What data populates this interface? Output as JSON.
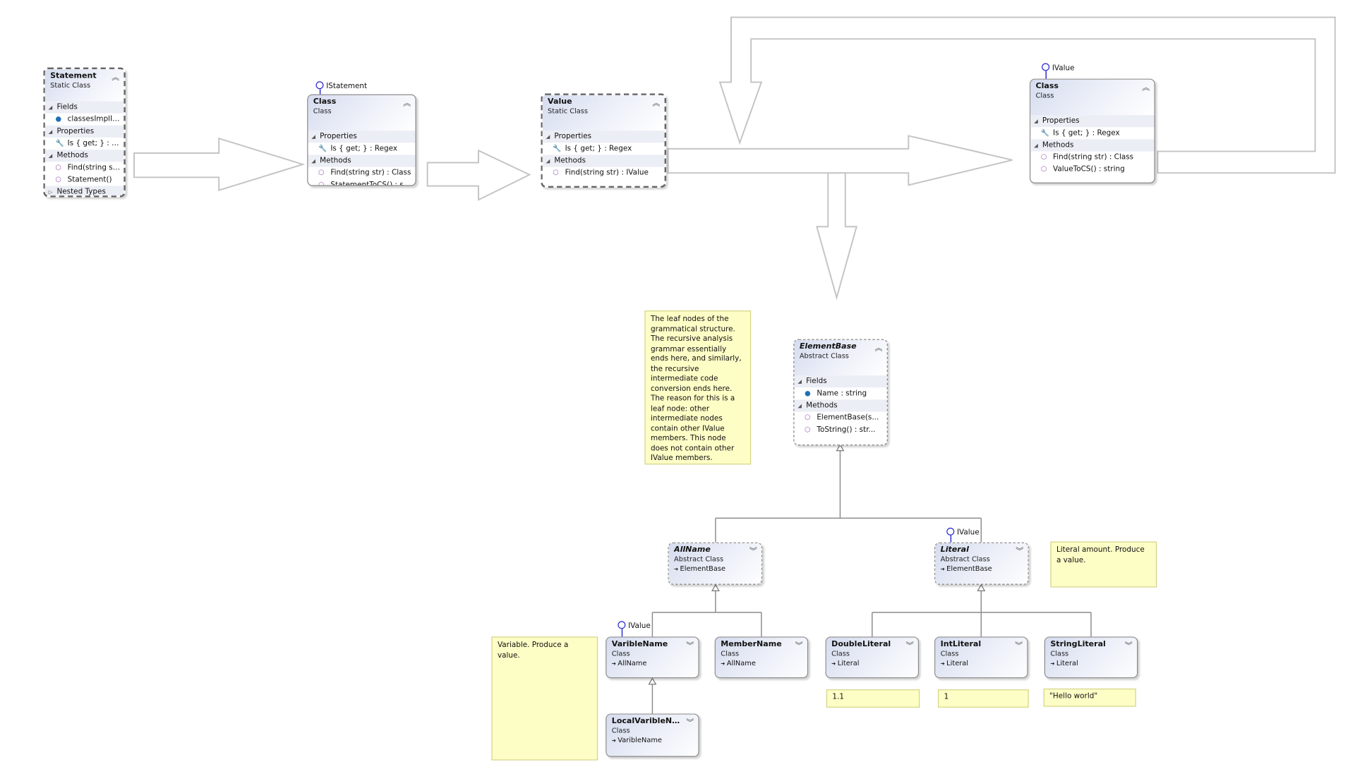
{
  "classes": [
    {
      "id": "statement",
      "name": "Statement",
      "stereotype": "Static Class",
      "style": "dashed",
      "collapse_icon": "chevron-double-up",
      "sections": [
        {
          "label": "Fields",
          "members": [
            {
              "icon": "field-private-icon",
              "text": "classesImplISt..."
            }
          ]
        },
        {
          "label": "Properties",
          "members": [
            {
              "icon": "property-wrench-icon",
              "text": "Is { get; } : Reg..."
            }
          ]
        },
        {
          "label": "Methods",
          "members": [
            {
              "icon": "method-icon",
              "text": "Find(string str..."
            },
            {
              "icon": "method-private-icon",
              "text": "Statement()"
            }
          ]
        },
        {
          "label": "Nested Types",
          "collapsed": true,
          "members": []
        }
      ]
    },
    {
      "id": "class-istatement",
      "name": "Class",
      "stereotype": "Class",
      "style": "solid",
      "collapse_icon": "chevron-double-up",
      "interface": "IStatement",
      "sections": [
        {
          "label": "Properties",
          "members": [
            {
              "icon": "property-wrench-icon",
              "text": "Is { get; } : Regex"
            }
          ]
        },
        {
          "label": "Methods",
          "members": [
            {
              "icon": "method-icon",
              "text": "Find(string str) : Class"
            },
            {
              "icon": "method-icon",
              "text": "StatementToCS() : stri..."
            }
          ]
        }
      ]
    },
    {
      "id": "value",
      "name": "Value",
      "stereotype": "Static Class",
      "style": "dashed",
      "collapse_icon": "chevron-double-up",
      "sections": [
        {
          "label": "Properties",
          "members": [
            {
              "icon": "property-wrench-icon",
              "text": "Is { get; } : Regex"
            }
          ]
        },
        {
          "label": "Methods",
          "members": [
            {
              "icon": "method-icon",
              "text": "Find(string str) : IValue"
            }
          ]
        }
      ]
    },
    {
      "id": "class-ivalue",
      "name": "Class",
      "stereotype": "Class",
      "style": "solid",
      "collapse_icon": "chevron-double-up",
      "interface": "IValue",
      "sections": [
        {
          "label": "Properties",
          "members": [
            {
              "icon": "property-wrench-icon",
              "text": "Is { get; } : Regex"
            }
          ]
        },
        {
          "label": "Methods",
          "members": [
            {
              "icon": "method-icon",
              "text": "Find(string str) : Class"
            },
            {
              "icon": "method-icon",
              "text": "ValueToCS() : string"
            }
          ]
        }
      ]
    },
    {
      "id": "elementbase",
      "name": "ElementBase",
      "italic": true,
      "stereotype": "Abstract Class",
      "style": "dotted",
      "collapse_icon": "chevron-double-up",
      "sections": [
        {
          "label": "Fields",
          "members": [
            {
              "icon": "field-icon",
              "text": "Name : string"
            }
          ]
        },
        {
          "label": "Methods",
          "members": [
            {
              "icon": "method-protected-icon",
              "text": "ElementBase(s..."
            },
            {
              "icon": "method-icon",
              "text": "ToString() : str..."
            }
          ]
        }
      ]
    },
    {
      "id": "allname",
      "name": "AllName",
      "italic": true,
      "stereotype": "Abstract Class",
      "base": "ElementBase",
      "style": "dotted",
      "collapse_icon": "chevron-double-down"
    },
    {
      "id": "literal",
      "name": "Literal",
      "italic": true,
      "stereotype": "Abstract Class",
      "base": "ElementBase",
      "style": "dotted",
      "collapse_icon": "chevron-double-down",
      "interface": "IValue"
    },
    {
      "id": "variblename",
      "name": "VaribleName",
      "stereotype": "Class",
      "base": "AllName",
      "style": "solid",
      "collapse_icon": "chevron-double-down",
      "interface": "IValue"
    },
    {
      "id": "membername",
      "name": "MemberName",
      "stereotype": "Class",
      "base": "AllName",
      "style": "solid",
      "collapse_icon": "chevron-double-down"
    },
    {
      "id": "doubleliteral",
      "name": "DoubleLiteral",
      "stereotype": "Class",
      "base": "Literal",
      "style": "solid",
      "collapse_icon": "chevron-double-down"
    },
    {
      "id": "intliteral",
      "name": "IntLiteral",
      "stereotype": "Class",
      "base": "Literal",
      "style": "solid",
      "collapse_icon": "chevron-double-down"
    },
    {
      "id": "stringliteral",
      "name": "StringLiteral",
      "stereotype": "Class",
      "base": "Literal",
      "style": "solid",
      "collapse_icon": "chevron-double-down"
    },
    {
      "id": "localvariblename",
      "name": "LocalVaribleNa...",
      "stereotype": "Class",
      "base": "VaribleName",
      "style": "solid",
      "collapse_icon": "chevron-double-down"
    }
  ],
  "notes": [
    {
      "id": "leaf-note",
      "text": "The leaf nodes of the grammatical structure. The recursive analysis grammar essentially ends here, and similarly, the recursive intermediate code conversion ends here. The reason for this is a leaf node: other intermediate nodes contain other IValue members. This node does not contain other IValue members."
    },
    {
      "id": "literal-note",
      "text": "Literal amount. Produce a value."
    },
    {
      "id": "variable-note",
      "text": "Variable. Produce a value."
    },
    {
      "id": "double-note",
      "text": "1.1"
    },
    {
      "id": "int-note",
      "text": "1"
    },
    {
      "id": "string-note",
      "text": "\"Hello world\""
    }
  ],
  "colors": {
    "note_bg": "#fdfdc6",
    "interface_lollipop": "#2a2ad0",
    "arrow_stroke": "#bdbdbd",
    "connector": "#8c8c8c"
  }
}
